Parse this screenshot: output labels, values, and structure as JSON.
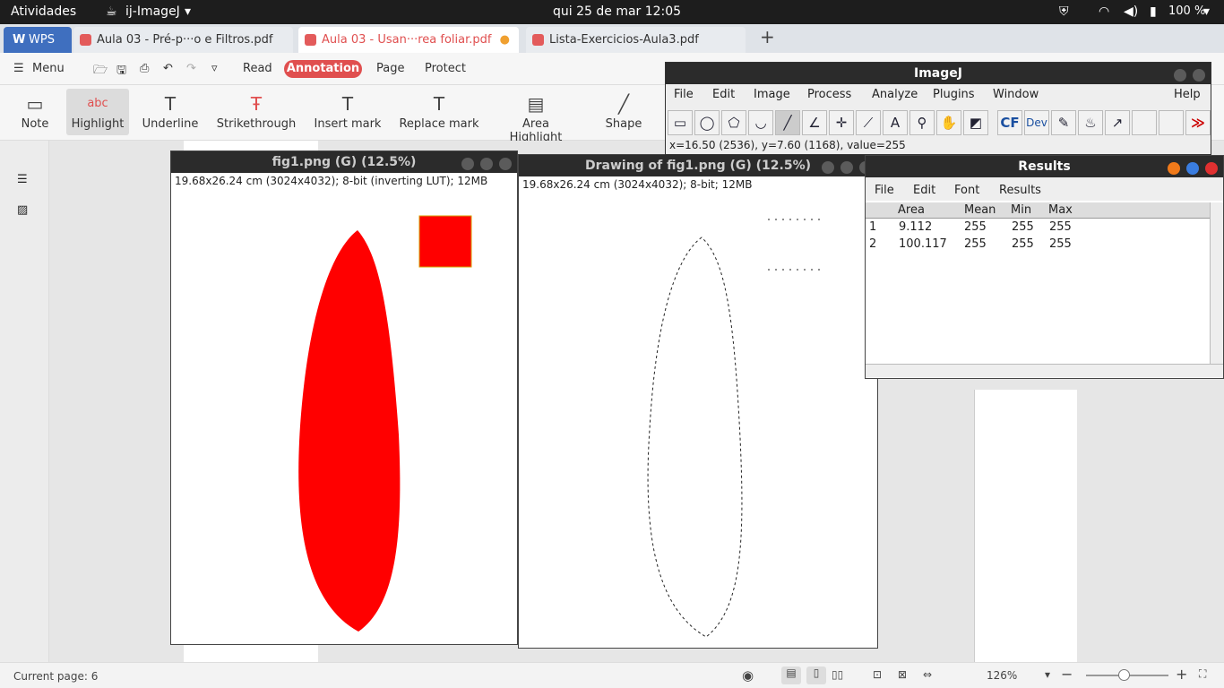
{
  "topbar": {
    "activities": "Atividades",
    "app": "ij-ImageJ",
    "clock": "qui 25 de mar  12:05",
    "battery": "100 %"
  },
  "tabs": {
    "wps": "WPS",
    "tab1": "Aula 03 - Pré-p···o e Filtros.pdf",
    "tab2": "Aula 03 - Usan···rea foliar.pdf",
    "tab3": "Lista-Exercicios-Aula3.pdf"
  },
  "menubar": {
    "menu": "Menu",
    "read": "Read",
    "annotation": "Annotation",
    "page": "Page",
    "protect": "Protect"
  },
  "toolbar": {
    "note": "Note",
    "highlight": "Highlight",
    "underline": "Underline",
    "strikethrough": "Strikethrough",
    "insert": "Insert mark",
    "replace": "Replace mark",
    "area": "Area Highlight",
    "shape": "Shape"
  },
  "status": {
    "page": "Current page: 6",
    "zoom": "126%"
  },
  "fig1": {
    "title": "fig1.png (G) (12.5%)",
    "info": "19.68x26.24 cm (3024x4032); 8-bit (inverting LUT); 12MB"
  },
  "drawing": {
    "title": "Drawing of fig1.png (G) (12.5%)",
    "info": "19.68x26.24 cm (3024x4032); 8-bit; 12MB"
  },
  "imagej": {
    "title": "ImageJ",
    "menus": [
      "File",
      "Edit",
      "Image",
      "Process",
      "Analyze",
      "Plugins",
      "Window",
      "Help"
    ],
    "status": "x=16.50 (2536), y=7.60 (1168), value=255",
    "cf": "CF",
    "dev": "Dev"
  },
  "results": {
    "title": "Results",
    "menus": [
      "File",
      "Edit",
      "Font",
      "Results"
    ],
    "headers": [
      "Area",
      "Mean",
      "Min",
      "Max"
    ],
    "rows": [
      [
        "1",
        "9.112",
        "255",
        "255",
        "255"
      ],
      [
        "2",
        "100.117",
        "255",
        "255",
        "255"
      ]
    ]
  },
  "colors": {
    "accent": "#e04f4f",
    "roi": "#ff0000"
  }
}
